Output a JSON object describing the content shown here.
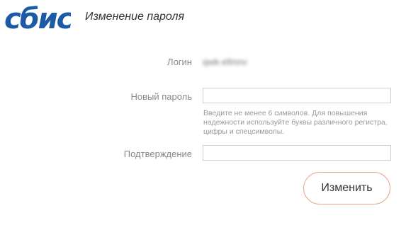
{
  "header": {
    "logo_text": "сбис",
    "title": "Изменение пароля"
  },
  "form": {
    "login_label": "Логин",
    "login_value": "qwk-efmnv",
    "new_password_label": "Новый пароль",
    "new_password_value": "",
    "password_hint": "Введите не менее 6 символов. Для повышения надежности используйте буквы различного регистра, цифры и спецсимволы.",
    "confirm_label": "Подтверждение",
    "confirm_value": "",
    "submit_label": "Изменить"
  },
  "colors": {
    "brand": "#1c5aa6",
    "button_border": "#e8a684"
  }
}
